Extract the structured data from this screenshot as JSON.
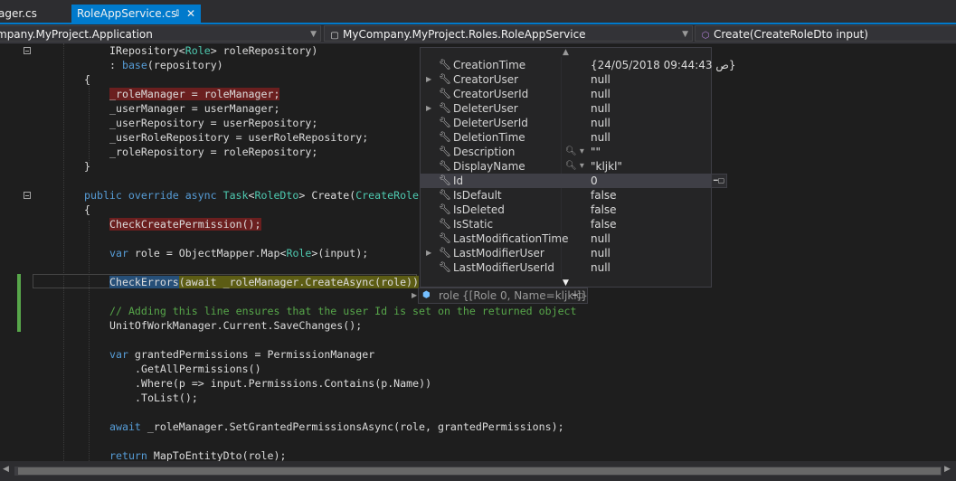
{
  "tabs": [
    {
      "label": "ager.cs"
    },
    {
      "label": "RoleAppService.cs"
    }
  ],
  "navbar": {
    "project": "mpany.MyProject.Application",
    "type": "MyCompany.MyProject.Roles.RoleAppService",
    "member": "Create(CreateRoleDto input)"
  },
  "code": {
    "l1a": "IRepository<",
    "l1b": "Role",
    "l1c": "> roleRepository)",
    "l2a": ": ",
    "l2b": "base",
    "l2c": "(repository)",
    "l3": "{",
    "l4": "_roleManager = roleManager;",
    "l5": "_userManager = userManager;",
    "l6": "_userRepository = userRepository;",
    "l7": "_userRoleRepository = userRoleRepository;",
    "l8": "_roleRepository = roleRepository;",
    "l9": "}",
    "l10a": "public",
    "l10b": "override",
    "l10c": "async",
    "l10d": "Task",
    "l10e": "<",
    "l10f": "RoleDto",
    "l10g": "> Create(",
    "l10h": "CreateRole",
    "l11": "{",
    "l12": "CheckCreatePermission();",
    "l13a": "var",
    "l13b": " role = ObjectMapper.Map<",
    "l13c": "Role",
    "l13d": ">(input);",
    "l14a": "CheckErrors",
    "l14b": "(await _roleManager.CreateAsync(role))",
    "l15": "// Adding this line ensures that the user Id is set on the returned object",
    "l16": "UnitOfWorkManager.Current.SaveChanges();",
    "l17a": "var",
    "l17b": " grantedPermissions = PermissionManager",
    "l18": ".GetAllPermissions()",
    "l19": ".Where(p => input.Permissions.Contains(p.Name))",
    "l20": ".ToList();",
    "l21a": "await",
    "l21b": " _roleManager.SetGrantedPermissionsAsync(role, grantedPermissions);",
    "l22a": "return",
    "l22b": " MapToEntityDto(role);"
  },
  "datatip": {
    "rows": [
      {
        "name": "CreationTime",
        "value": "{24/05/2018 09:44:43 ص}"
      },
      {
        "name": "CreatorUser",
        "value": "null"
      },
      {
        "name": "CreatorUserId",
        "value": "null"
      },
      {
        "name": "DeleterUser",
        "value": "null"
      },
      {
        "name": "DeleterUserId",
        "value": "null"
      },
      {
        "name": "DeletionTime",
        "value": "null"
      },
      {
        "name": "Description",
        "value": "\"\""
      },
      {
        "name": "DisplayName",
        "value": "\"kljkl\""
      },
      {
        "name": "Id",
        "value": "0"
      },
      {
        "name": "IsDefault",
        "value": "false"
      },
      {
        "name": "IsDeleted",
        "value": "false"
      },
      {
        "name": "IsStatic",
        "value": "false"
      },
      {
        "name": "LastModificationTime",
        "value": "null"
      },
      {
        "name": "LastModifierUser",
        "value": "null"
      },
      {
        "name": "LastModifierUserId",
        "value": "null"
      }
    ]
  },
  "roletip": {
    "name": "role",
    "value": "{[Role 0, Name=kljkl]}"
  },
  "icons": {
    "property": "wrench-icon",
    "object": "object-icon",
    "pin": "pin-icon",
    "magnifier": "magnifier-icon"
  },
  "colors": {
    "accent": "#007acc",
    "error_highlight": "#6b1f1f",
    "current_statement": "#5c5c14",
    "comment": "#57a64a",
    "keyword": "#569cd6",
    "type": "#4ec9b0"
  }
}
